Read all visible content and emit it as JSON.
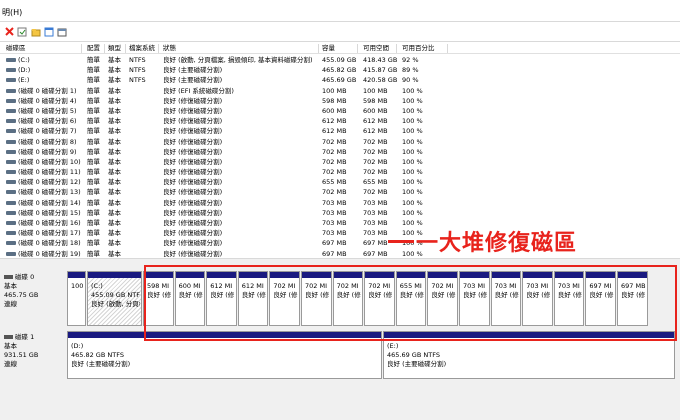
{
  "menu": {
    "help": "明(H)"
  },
  "toolbar": {
    "icons": [
      "close-icon",
      "properties-icon",
      "folder-icon",
      "help-icon"
    ],
    "colors": {
      "close": "#e8231c",
      "folder": "#f4c542",
      "help": "#3a7bd5"
    }
  },
  "volume_table": {
    "headers": [
      "磁碟區",
      "配置",
      "類型",
      "檔案系統",
      "狀態",
      "容量",
      "可用空間",
      "可用百分比"
    ],
    "rows": [
      [
        "(C:)",
        "簡單",
        "基本",
        "NTFS",
        "良好 (啟動, 分頁檔案, 損毀傾印, 基本資料磁碟分割)",
        "455.09 GB",
        "418.43 GB",
        "92 %"
      ],
      [
        "(D:)",
        "簡單",
        "基本",
        "NTFS",
        "良好 (主要磁碟分割)",
        "465.82 GB",
        "415.87 GB",
        "89 %"
      ],
      [
        "(E:)",
        "簡單",
        "基本",
        "NTFS",
        "良好 (主要磁碟分割)",
        "465.69 GB",
        "420.58 GB",
        "90 %"
      ],
      [
        "(磁碟 0 磁碟分割 1)",
        "簡單",
        "基本",
        "",
        "良好 (EFI 系統磁碟分割)",
        "100 MB",
        "100 MB",
        "100 %"
      ],
      [
        "(磁碟 0 磁碟分割 4)",
        "簡單",
        "基本",
        "",
        "良好 (修復磁碟分割)",
        "598 MB",
        "598 MB",
        "100 %"
      ],
      [
        "(磁碟 0 磁碟分割 5)",
        "簡單",
        "基本",
        "",
        "良好 (修復磁碟分割)",
        "600 MB",
        "600 MB",
        "100 %"
      ],
      [
        "(磁碟 0 磁碟分割 6)",
        "簡單",
        "基本",
        "",
        "良好 (修復磁碟分割)",
        "612 MB",
        "612 MB",
        "100 %"
      ],
      [
        "(磁碟 0 磁碟分割 7)",
        "簡單",
        "基本",
        "",
        "良好 (修復磁碟分割)",
        "612 MB",
        "612 MB",
        "100 %"
      ],
      [
        "(磁碟 0 磁碟分割 8)",
        "簡單",
        "基本",
        "",
        "良好 (修復磁碟分割)",
        "702 MB",
        "702 MB",
        "100 %"
      ],
      [
        "(磁碟 0 磁碟分割 9)",
        "簡單",
        "基本",
        "",
        "良好 (修復磁碟分割)",
        "702 MB",
        "702 MB",
        "100 %"
      ],
      [
        "(磁碟 0 磁碟分割 10)",
        "簡單",
        "基本",
        "",
        "良好 (修復磁碟分割)",
        "702 MB",
        "702 MB",
        "100 %"
      ],
      [
        "(磁碟 0 磁碟分割 11)",
        "簡單",
        "基本",
        "",
        "良好 (修復磁碟分割)",
        "702 MB",
        "702 MB",
        "100 %"
      ],
      [
        "(磁碟 0 磁碟分割 12)",
        "簡單",
        "基本",
        "",
        "良好 (修復磁碟分割)",
        "655 MB",
        "655 MB",
        "100 %"
      ],
      [
        "(磁碟 0 磁碟分割 13)",
        "簡單",
        "基本",
        "",
        "良好 (修復磁碟分割)",
        "702 MB",
        "702 MB",
        "100 %"
      ],
      [
        "(磁碟 0 磁碟分割 14)",
        "簡單",
        "基本",
        "",
        "良好 (修復磁碟分割)",
        "703 MB",
        "703 MB",
        "100 %"
      ],
      [
        "(磁碟 0 磁碟分割 15)",
        "簡單",
        "基本",
        "",
        "良好 (修復磁碟分割)",
        "703 MB",
        "703 MB",
        "100 %"
      ],
      [
        "(磁碟 0 磁碟分割 16)",
        "簡單",
        "基本",
        "",
        "良好 (修復磁碟分割)",
        "703 MB",
        "703 MB",
        "100 %"
      ],
      [
        "(磁碟 0 磁碟分割 17)",
        "簡單",
        "基本",
        "",
        "良好 (修復磁碟分割)",
        "703 MB",
        "703 MB",
        "100 %"
      ],
      [
        "(磁碟 0 磁碟分割 18)",
        "簡單",
        "基本",
        "",
        "良好 (修復磁碟分割)",
        "697 MB",
        "697 MB",
        "100 %"
      ],
      [
        "(磁碟 0 磁碟分割 19)",
        "簡單",
        "基本",
        "",
        "良好 (修復磁碟分割)",
        "697 MB",
        "697 MB",
        "100 %"
      ]
    ]
  },
  "disks": [
    {
      "name": "磁碟 0",
      "type": "基本",
      "size": "465.75 GB",
      "status": "連線",
      "partitions": [
        {
          "label": "",
          "size": "100",
          "status": "",
          "hatched": false
        },
        {
          "label": "(C:)",
          "size": "455.09 GB NTFS",
          "status": "良好 (啟動, 分頁檔",
          "hatched": true
        },
        {
          "label": "",
          "size": "598 MI",
          "status": "良好 (修",
          "hatched": false
        },
        {
          "label": "",
          "size": "600 MI",
          "status": "良好 (修",
          "hatched": false
        },
        {
          "label": "",
          "size": "612 MI",
          "status": "良好 (修",
          "hatched": false
        },
        {
          "label": "",
          "size": "612 MI",
          "status": "良好 (修",
          "hatched": false
        },
        {
          "label": "",
          "size": "702 MI",
          "status": "良好 (修",
          "hatched": false
        },
        {
          "label": "",
          "size": "702 MI",
          "status": "良好 (修",
          "hatched": false
        },
        {
          "label": "",
          "size": "702 MI",
          "status": "良好 (修",
          "hatched": false
        },
        {
          "label": "",
          "size": "702 MI",
          "status": "良好 (修",
          "hatched": false
        },
        {
          "label": "",
          "size": "655 MI",
          "status": "良好 (修",
          "hatched": false
        },
        {
          "label": "",
          "size": "702 MI",
          "status": "良好 (修",
          "hatched": false
        },
        {
          "label": "",
          "size": "703 MI",
          "status": "良好 (修",
          "hatched": false
        },
        {
          "label": "",
          "size": "703 MI",
          "status": "良好 (修",
          "hatched": false
        },
        {
          "label": "",
          "size": "703 MI",
          "status": "良好 (修",
          "hatched": false
        },
        {
          "label": "",
          "size": "703 MI",
          "status": "良好 (修",
          "hatched": false
        },
        {
          "label": "",
          "size": "697 MI",
          "status": "良好 (修",
          "hatched": false
        },
        {
          "label": "",
          "size": "697 MB",
          "status": "良好 (修",
          "hatched": false
        }
      ]
    },
    {
      "name": "磁碟 1",
      "type": "基本",
      "size": "931.51 GB",
      "status": "連線",
      "partitions": [
        {
          "label": "(D:)",
          "size": "465.82 GB NTFS",
          "status": "良好 (主要磁碟分割)",
          "hatched": false
        },
        {
          "label": "(E:)",
          "size": "465.69 GB NTFS",
          "status": "良好 (主要磁碟分割)",
          "hatched": false
        }
      ]
    }
  ],
  "annotation": {
    "text": "一大堆修復磁區",
    "color": "#e8231c"
  },
  "colors": {
    "partition_bar": "#1a1a80",
    "highlight": "#e8231c"
  }
}
